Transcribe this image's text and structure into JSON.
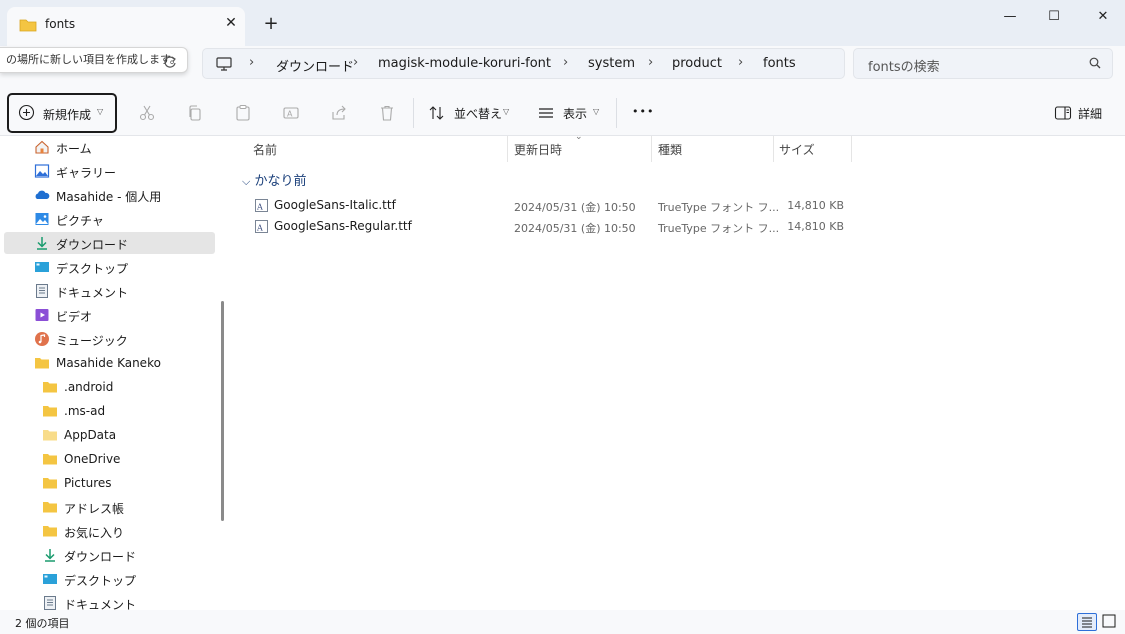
{
  "window": {
    "tab_title": "fonts",
    "tab_close": "✕",
    "new_tab": "+",
    "minimize": "—",
    "maximize": "☐",
    "close": "✕"
  },
  "tooltip": "の場所に新しい項目を作成します。",
  "breadcrumb": [
    "ダウンロード",
    "magisk-module-koruri-font",
    "system",
    "product",
    "fonts"
  ],
  "search": {
    "placeholder": "fontsの検索"
  },
  "toolbar": {
    "new_label": "新規作成",
    "sort_label": "並べ替え",
    "view_label": "表示",
    "more_label": "•••",
    "details_label": "詳細"
  },
  "nav": {
    "items": [
      {
        "label": "ホーム",
        "icon": "home-icon"
      },
      {
        "label": "ギャラリー",
        "icon": "gallery-icon"
      },
      {
        "label": "Masahide - 個人用",
        "icon": "cloud-icon"
      },
      {
        "label": "ピクチャ",
        "icon": "pictures-icon"
      },
      {
        "label": "ダウンロード",
        "icon": "download-icon"
      },
      {
        "label": "デスクトップ",
        "icon": "desktop-icon"
      },
      {
        "label": "ドキュメント",
        "icon": "document-icon"
      },
      {
        "label": "ビデオ",
        "icon": "video-icon"
      },
      {
        "label": "ミュージック",
        "icon": "music-icon"
      },
      {
        "label": "Masahide Kaneko",
        "icon": "folder-icon"
      },
      {
        "label": ".android",
        "icon": "folder-icon"
      },
      {
        "label": ".ms-ad",
        "icon": "folder-icon"
      },
      {
        "label": "AppData",
        "icon": "folder-icon"
      },
      {
        "label": "OneDrive",
        "icon": "folder-icon"
      },
      {
        "label": "Pictures",
        "icon": "folder-icon"
      },
      {
        "label": "アドレス帳",
        "icon": "folder-icon"
      },
      {
        "label": "お気に入り",
        "icon": "folder-icon"
      },
      {
        "label": "ダウンロード",
        "icon": "download-icon"
      },
      {
        "label": "デスクトップ",
        "icon": "desktop-icon"
      },
      {
        "label": "ドキュメント",
        "icon": "document-icon"
      }
    ]
  },
  "columns": {
    "name": "名前",
    "date": "更新日時",
    "type": "種類",
    "size": "サイズ"
  },
  "group_label": "かなり前",
  "files": [
    {
      "name": "GoogleSans-Italic.ttf",
      "date": "2024/05/31 (金) 10:50",
      "type": "TrueType フォント フ...",
      "size": "14,810 KB"
    },
    {
      "name": "GoogleSans-Regular.ttf",
      "date": "2024/05/31 (金) 10:50",
      "type": "TrueType フォント フ...",
      "size": "14,810 KB"
    }
  ],
  "status": {
    "item_count": "2 個の項目"
  },
  "colors": {
    "accent": "#2e6fd8",
    "folder": "#f4c542",
    "selected": "#e5e5e5"
  }
}
